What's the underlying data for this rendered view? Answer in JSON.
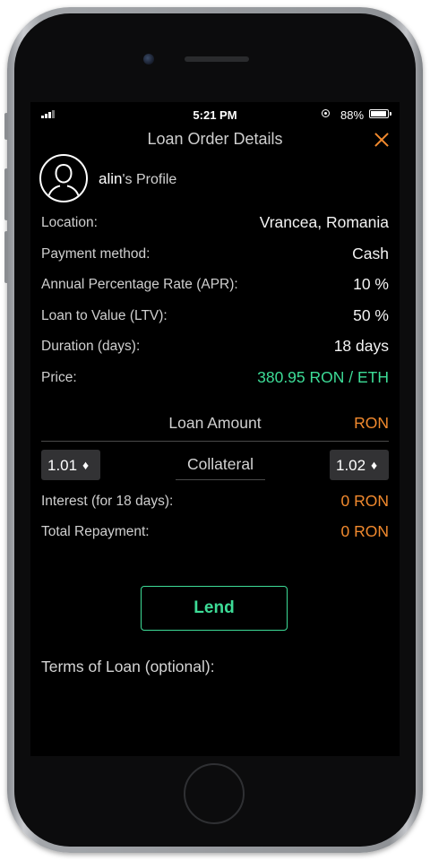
{
  "status_bar": {
    "time": "5:21 PM",
    "battery_percent": "88%"
  },
  "header": {
    "title": "Loan Order Details",
    "close_icon": "close-icon",
    "accent_color": "#f28a2e"
  },
  "profile": {
    "name": "alin",
    "suffix": "'s Profile"
  },
  "details": {
    "location": {
      "label": "Location:",
      "value": "Vrancea, Romania"
    },
    "payment_method": {
      "label": "Payment method:",
      "value": "Cash"
    },
    "apr": {
      "label": "Annual Percentage Rate (APR):",
      "value": "10 %"
    },
    "ltv": {
      "label": "Loan to Value (LTV):",
      "value": "50 %"
    },
    "duration": {
      "label": "Duration (days):",
      "value": "18 days"
    },
    "price": {
      "label": "Price:",
      "value": "380.95 RON / ETH"
    }
  },
  "loan_amount": {
    "label": "Loan Amount",
    "currency": "RON"
  },
  "collateral": {
    "label": "Collateral",
    "left_value": "1.01",
    "right_value": "1.02",
    "unit_symbol": "♦"
  },
  "interest": {
    "label": "Interest (for 18 days):",
    "value": "0 RON"
  },
  "total_repayment": {
    "label": "Total Repayment:",
    "value": "0 RON"
  },
  "lend_button": {
    "label": "Lend"
  },
  "terms": {
    "label": "Terms of Loan (optional):"
  },
  "colors": {
    "green": "#3ddc97",
    "orange": "#f28a2e",
    "background": "#000000"
  }
}
